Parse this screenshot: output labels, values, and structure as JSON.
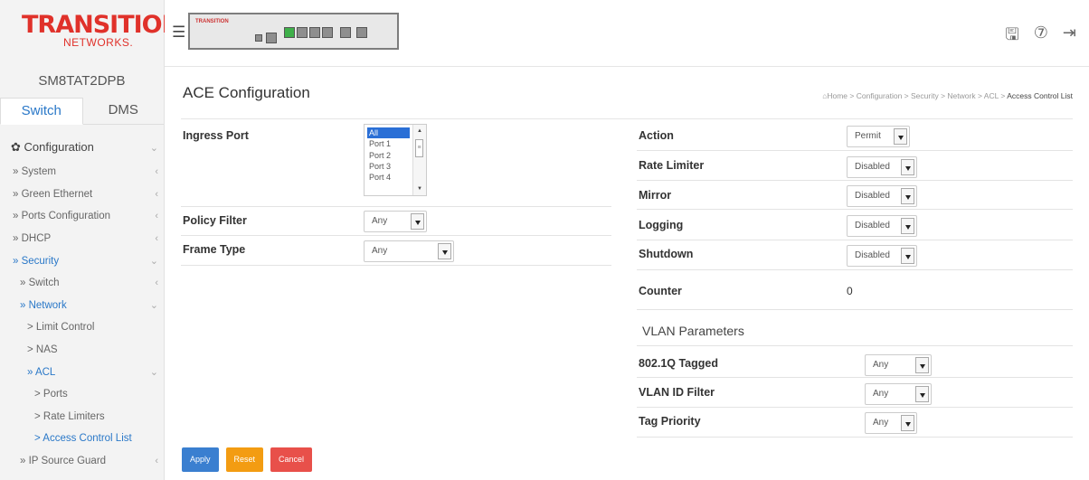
{
  "brand": {
    "line1": "TRANSITION",
    "line2": "NETWORKS."
  },
  "model": "SM8TAT2DPB",
  "tabs": [
    {
      "label": "Switch"
    },
    {
      "label": "DMS"
    }
  ],
  "menu": {
    "configuration": "Configuration",
    "items": [
      "» System",
      "» Green Ethernet",
      "» Ports Configuration",
      "» DHCP",
      "» Security",
      "» Switch",
      "» Network",
      "> Limit Control",
      "> NAS",
      "» ACL",
      "> Ports",
      "> Rate Limiters",
      "> Access Control List",
      "» IP Source Guard"
    ]
  },
  "device": {
    "brand": "TRANSITION"
  },
  "page": {
    "title": "ACE Configuration",
    "breadcrumb": [
      "Home",
      "Configuration",
      "Security",
      "Network",
      "ACL",
      "Access Control List"
    ]
  },
  "left": {
    "ingress_port": {
      "label": "Ingress Port",
      "options": [
        "All",
        "Port 1",
        "Port 2",
        "Port 3",
        "Port 4"
      ],
      "selected": "All"
    },
    "policy_filter": {
      "label": "Policy Filter",
      "value": "Any"
    },
    "frame_type": {
      "label": "Frame Type",
      "value": "Any"
    }
  },
  "right": {
    "action": {
      "label": "Action",
      "value": "Permit"
    },
    "rate_limiter": {
      "label": "Rate Limiter",
      "value": "Disabled"
    },
    "mirror": {
      "label": "Mirror",
      "value": "Disabled"
    },
    "logging": {
      "label": "Logging",
      "value": "Disabled"
    },
    "shutdown": {
      "label": "Shutdown",
      "value": "Disabled"
    },
    "counter": {
      "label": "Counter",
      "value": "0"
    },
    "vlan_section": "VLAN Parameters",
    "tagged": {
      "label": "802.1Q Tagged",
      "value": "Any"
    },
    "vid_filter": {
      "label": "VLAN ID Filter",
      "value": "Any"
    },
    "tag_priority": {
      "label": "Tag Priority",
      "value": "Any"
    }
  },
  "buttons": {
    "apply": "Apply",
    "reset": "Reset",
    "cancel": "Cancel"
  }
}
